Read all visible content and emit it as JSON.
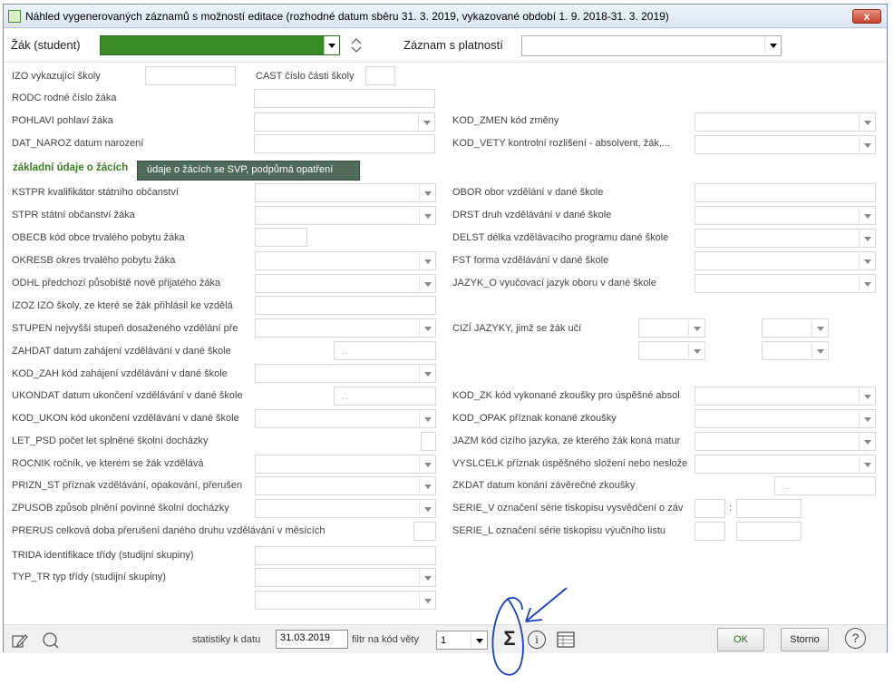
{
  "window": {
    "title": "Náhled vygenerovaných záznamů s možností editace (rozhodné datum sběru 31. 3. 2019, vykazované období 1. 9. 2018-31. 3. 2019)",
    "close": "x"
  },
  "header": {
    "student_label": "Žák (student)",
    "record_label": "Záznam s platností",
    "accent_color": "#3a8a25"
  },
  "fields": {
    "izo": "IZO vykazující školy",
    "cast": "CAST číslo části školy",
    "rodc": "RODC rodné číslo žáka",
    "pohlavi": "POHLAVI pohlaví žáka",
    "kod_zmen": "KOD_ZMEN kód změny",
    "dat_naroz": "DAT_NAROZ datum narození",
    "kod_vety": "KOD_VETY kontrolní rozlišení - absolvent, žák,...",
    "kstpr": "KSTPR kvalifikátor státního občanství",
    "obor": "OBOR obor vzdělání v dané škole",
    "stpr": "STPR státní občanství žáka",
    "drst": "DRST druh vzdělávání v dané škole",
    "obecb": "OBECB kód obce trvalého pobytu žáka",
    "delst": "DELST délka vzdělávacího programu dané škole",
    "okresb": "OKRESB okres trvalého pobytu žáka",
    "fst": "FST forma vzdělávání v dané škole",
    "odhl": "ODHL předchozí působiště nově přijatého žáka",
    "jazyk_o": "JAZYK_O vyučovací jazyk oboru v dané škole",
    "izoz": "IZOZ IZO školy, ze které se žák přihlásil ke vzdělá",
    "stupen": "STUPEN nejvyšší stupeň dosaženého vzdělání pře",
    "cizi": "CIZÍ JAZYKY, jimž se žák učí",
    "zahdat": "ZAHDAT datum zahájení vzdělávání v dané škole",
    "kod_zah": "KOD_ZAH kód zahájení vzdělávání v dané škole",
    "ukondat": "UKONDAT datum ukončení vzdělávání v dané škole",
    "kod_zk": "KOD_ZK kód vykonané zkoušky pro úspěšné absol",
    "kod_ukon": "KOD_UKON kód ukončení vzdělávání v dané škole",
    "kod_opak": "KOD_OPAK příznak konané zkoušky",
    "let_psd": "LET_PSD počet let splněné školní docházky",
    "jazm": "JAZM kód cizího jazyka, ze kterého žák koná matur",
    "rocnik": "ROCNIK ročník, ve kterém se žák vzdělává",
    "vyslcelk": "VYSLCELK příznak úspěšného složení nebo neslože",
    "prizn_st": "PRIZN_ST příznak vzdělávání, opakování, přerušen",
    "zkdat": "ZKDAT datum konání závěrečné zkoušky",
    "zpusob": "ZPUSOB způsob plnění povinné školní docházky",
    "serie_v": "SERIE_V označení série tiskopisu vysvědčení o záv",
    "prerus": "PRERUS celková doba přerušení daného druhu vzdělávání v měsících",
    "serie_l": "SERIE_L označení série tiskopisu výučního listu",
    "trida": "TRIDA identifikace třídy (studijní skupiny)",
    "typ_tr": "TYP_TR typ třídy (studijní skupiny)",
    "date_dots": ". .",
    "colon": ":"
  },
  "tabs": {
    "active": "základní údaje o žácích",
    "other": "údaje o žácích se SVP, podpůrná opatření"
  },
  "bottom": {
    "stats_label": "statistiky k datu",
    "stats_date": "31.03.2019",
    "filter_label": "filtr na kód věty",
    "filter_value": "1",
    "ok": "OK",
    "storno": "Storno",
    "sigma": "Σ",
    "info": "i",
    "help": "?"
  },
  "icons": [
    "edit-icon",
    "search-icon",
    "sigma-icon",
    "info-icon",
    "table-icon",
    "help-icon"
  ]
}
